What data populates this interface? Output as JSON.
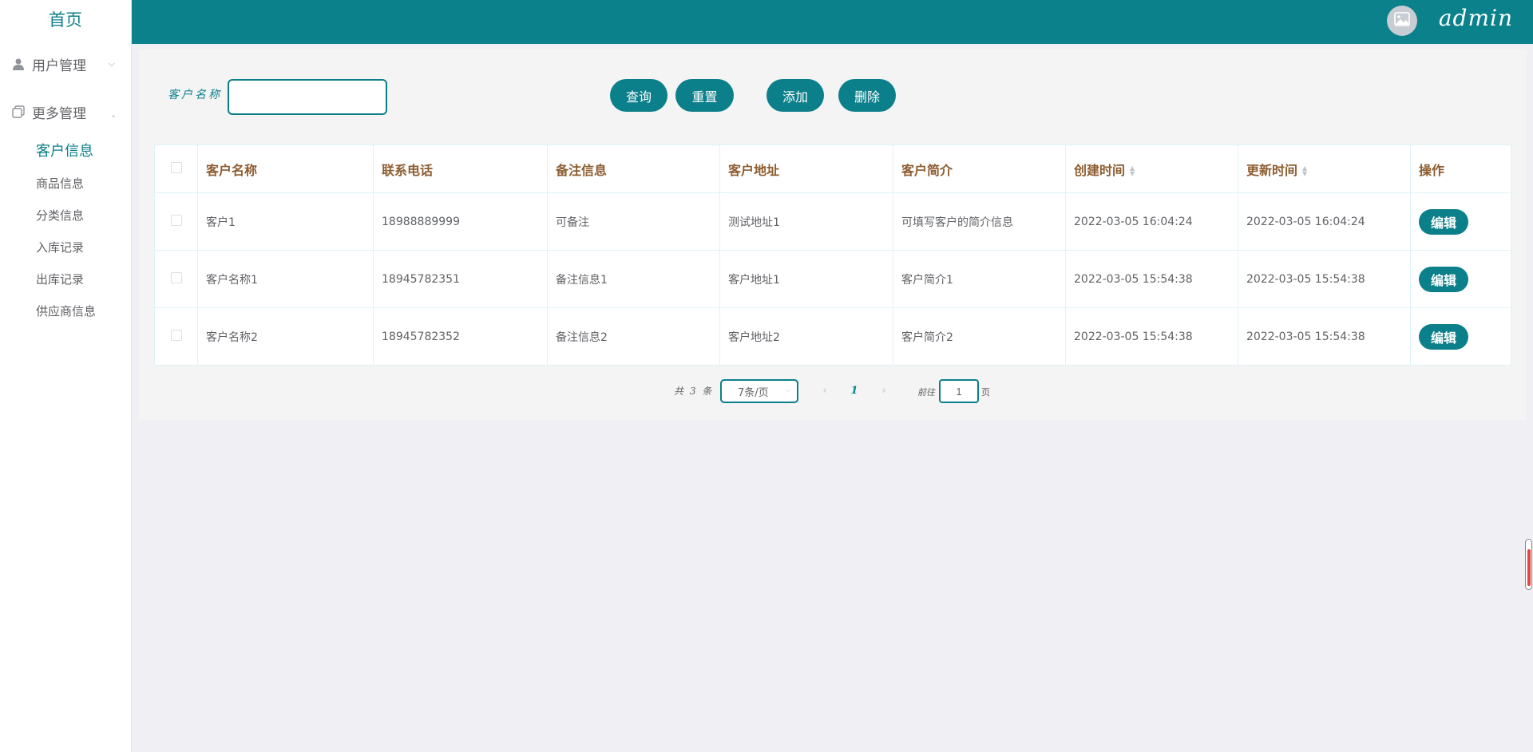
{
  "sidebar": {
    "home_label": "首页",
    "menus": [
      {
        "label": "用户管理",
        "icon": "user-icon",
        "expanded": false
      },
      {
        "label": "更多管理",
        "icon": "copy-icon",
        "expanded": true
      }
    ],
    "items": [
      {
        "label": "客户信息",
        "active": true
      },
      {
        "label": "商品信息",
        "active": false
      },
      {
        "label": "分类信息",
        "active": false
      },
      {
        "label": "入库记录",
        "active": false
      },
      {
        "label": "出库记录",
        "active": false
      },
      {
        "label": "供应商信息",
        "active": false
      }
    ]
  },
  "header": {
    "username": "admin",
    "avatar_icon": "image-icon"
  },
  "search": {
    "label": "客户名称",
    "value": "",
    "placeholder": ""
  },
  "toolbar": {
    "query_label": "查询",
    "reset_label": "重置",
    "add_label": "添加",
    "delete_label": "删除"
  },
  "table": {
    "columns": [
      "客户名称",
      "联系电话",
      "备注信息",
      "客户地址",
      "客户简介",
      "创建时间",
      "更新时间",
      "操作"
    ],
    "rows": [
      {
        "name": "客户1",
        "phone": "18988889999",
        "remark": "可备注",
        "address": "测试地址1",
        "intro": "可填写客户的简介信息",
        "created": "2022-03-05 16:04:24",
        "updated": "2022-03-05 16:04:24",
        "action": "编辑"
      },
      {
        "name": "客户名称1",
        "phone": "18945782351",
        "remark": "备注信息1",
        "address": "客户地址1",
        "intro": "客户简介1",
        "created": "2022-03-05 15:54:38",
        "updated": "2022-03-05 15:54:38",
        "action": "编辑"
      },
      {
        "name": "客户名称2",
        "phone": "18945782352",
        "remark": "备注信息2",
        "address": "客户地址2",
        "intro": "客户简介2",
        "created": "2022-03-05 15:54:38",
        "updated": "2022-03-05 15:54:38",
        "action": "编辑"
      }
    ]
  },
  "pagination": {
    "total_text": "共 3 条",
    "page_size": "7条/页",
    "current_page": "1",
    "goto_label": "前往",
    "goto_value": "1",
    "page_suffix": "页"
  },
  "colors": {
    "primary": "#0b7f8a",
    "header": "#0b818c",
    "header_text": "#8d5c2f"
  }
}
